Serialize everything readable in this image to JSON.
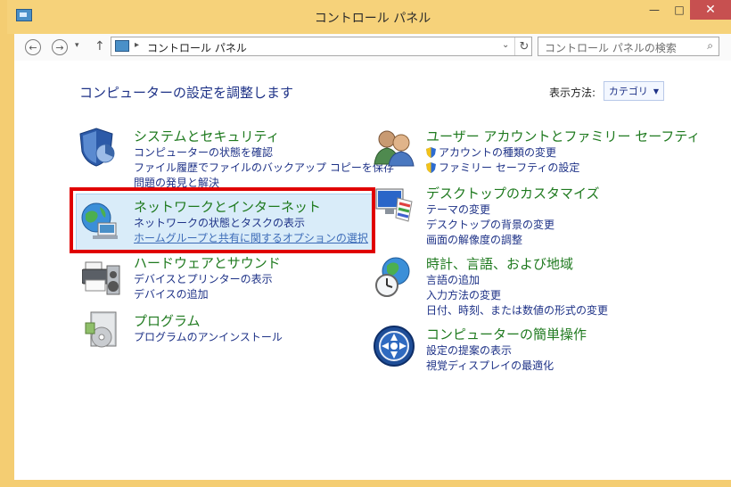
{
  "window": {
    "title": "コントロール パネル"
  },
  "titlebar": {
    "minimize": "—",
    "maximize": "□",
    "close": "✕"
  },
  "nav": {
    "back": "←",
    "forward": "→",
    "recent": "▾",
    "up": "↑",
    "address_sep": "▸",
    "address_text": "コントロール パネル",
    "address_drop": "⌄",
    "refresh": "↻",
    "search_placeholder": "コントロール パネルの検索",
    "search_glyph": "⌕"
  },
  "main": {
    "heading": "コンピューターの設定を調整します",
    "view_by_label": "表示方法:",
    "view_by_value": "カテゴリ",
    "view_by_caret": "▼"
  },
  "categories": [
    {
      "title": "システムとセキュリティ",
      "icon": "shield-pie-icon",
      "links": [
        "コンピューターの状態を確認",
        "ファイル履歴でファイルのバックアップ コピーを保存",
        "問題の発見と解決"
      ]
    },
    {
      "title": "ネットワークとインターネット",
      "icon": "globe-network-icon",
      "links": [
        "ネットワークの状態とタスクの表示",
        "ホームグループと共有に関するオプションの選択"
      ]
    },
    {
      "title": "ハードウェアとサウンド",
      "icon": "printer-speaker-icon",
      "links": [
        "デバイスとプリンターの表示",
        "デバイスの追加"
      ]
    },
    {
      "title": "プログラム",
      "icon": "program-box-icon",
      "links": [
        "プログラムのアンインストール"
      ]
    },
    {
      "title": "ユーザー アカウントとファミリー セーフティ",
      "icon": "users-icon",
      "links": [
        "アカウントの種類の変更",
        "ファミリー セーフティの設定"
      ]
    },
    {
      "title": "デスクトップのカスタマイズ",
      "icon": "monitor-palette-icon",
      "links": [
        "テーマの変更",
        "デスクトップの背景の変更",
        "画面の解像度の調整"
      ]
    },
    {
      "title": "時計、言語、および地域",
      "icon": "globe-clock-icon",
      "links": [
        "言語の追加",
        "入力方法の変更",
        "日付、時刻、または数値の形式の変更"
      ]
    },
    {
      "title": "コンピューターの簡単操作",
      "icon": "accessibility-icon",
      "links": [
        "設定の提案の表示",
        "視覚ディスプレイの最適化"
      ]
    }
  ],
  "colors": {
    "frame": "#f4cd72",
    "heading": "#1e3287",
    "category_title": "#1f7a1f",
    "highlight_border": "#e00000"
  }
}
